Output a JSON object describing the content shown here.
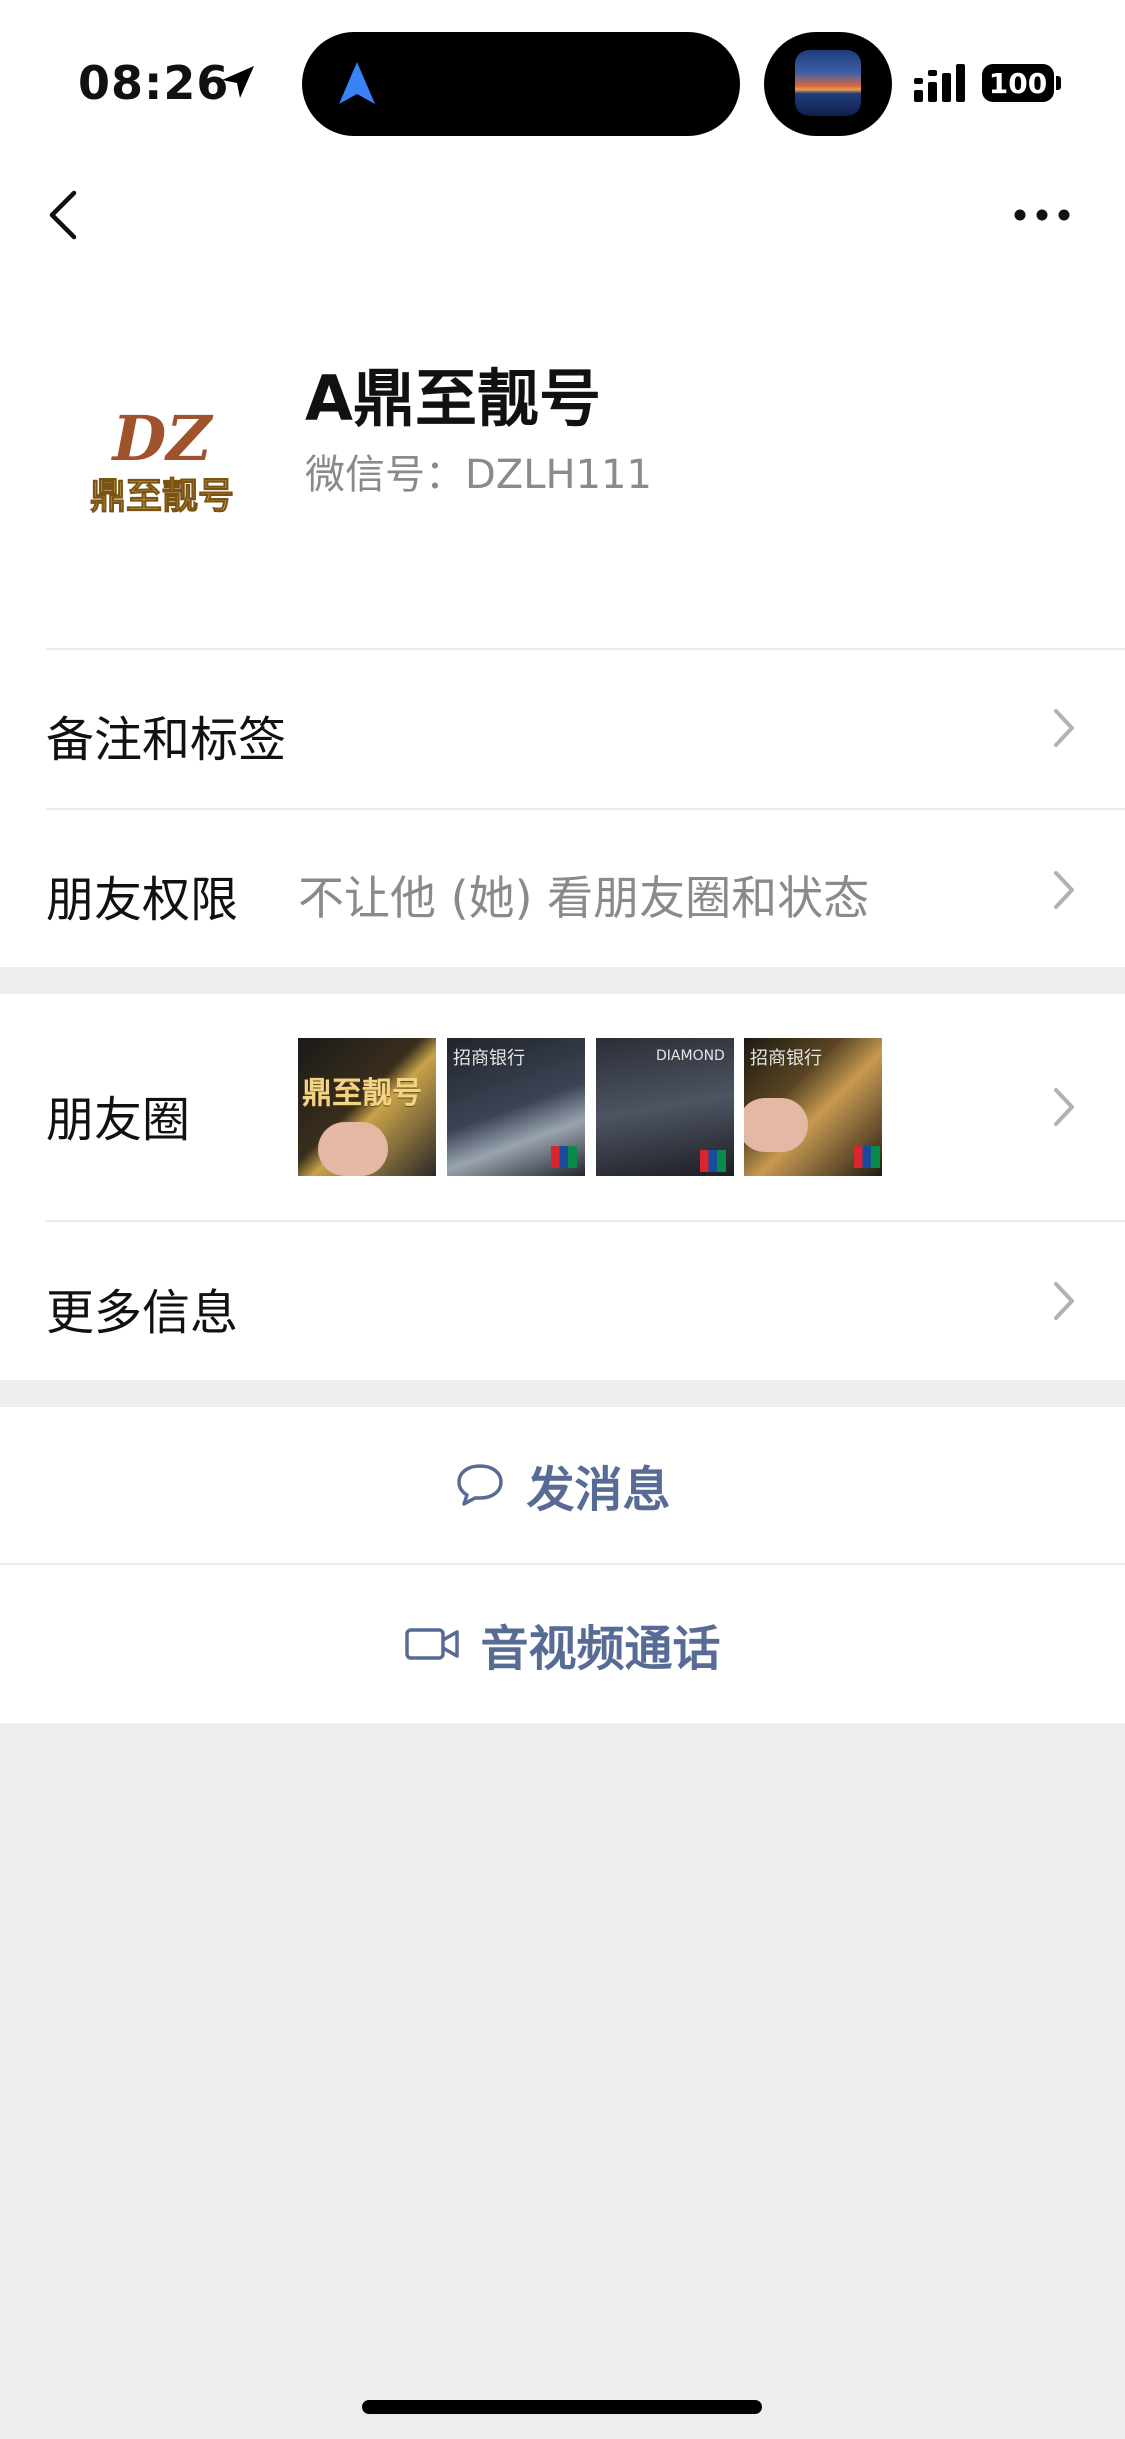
{
  "status_bar": {
    "time": "08:26",
    "battery": "100"
  },
  "profile": {
    "name": "A鼎至靓号",
    "wechat_id": "微信号：DZLH111",
    "avatar_text_top": "DZ",
    "avatar_text_bottom": "鼎至靓号"
  },
  "rows": {
    "remarks_tags": {
      "label": "备注和标签"
    },
    "friend_permissions": {
      "label": "朋友权限",
      "value": "不让他 (她) 看朋友圈和状态"
    },
    "moments": {
      "label": "朋友圈",
      "thumb_texts": [
        "鼎至靓号",
        "招商银行",
        "DIAMOND",
        "招商银行"
      ]
    },
    "more_info": {
      "label": "更多信息"
    }
  },
  "actions": {
    "message": "发消息",
    "call": "音视频通话"
  },
  "colors": {
    "link_blue": "#576b95",
    "background_gray": "#ededed"
  }
}
